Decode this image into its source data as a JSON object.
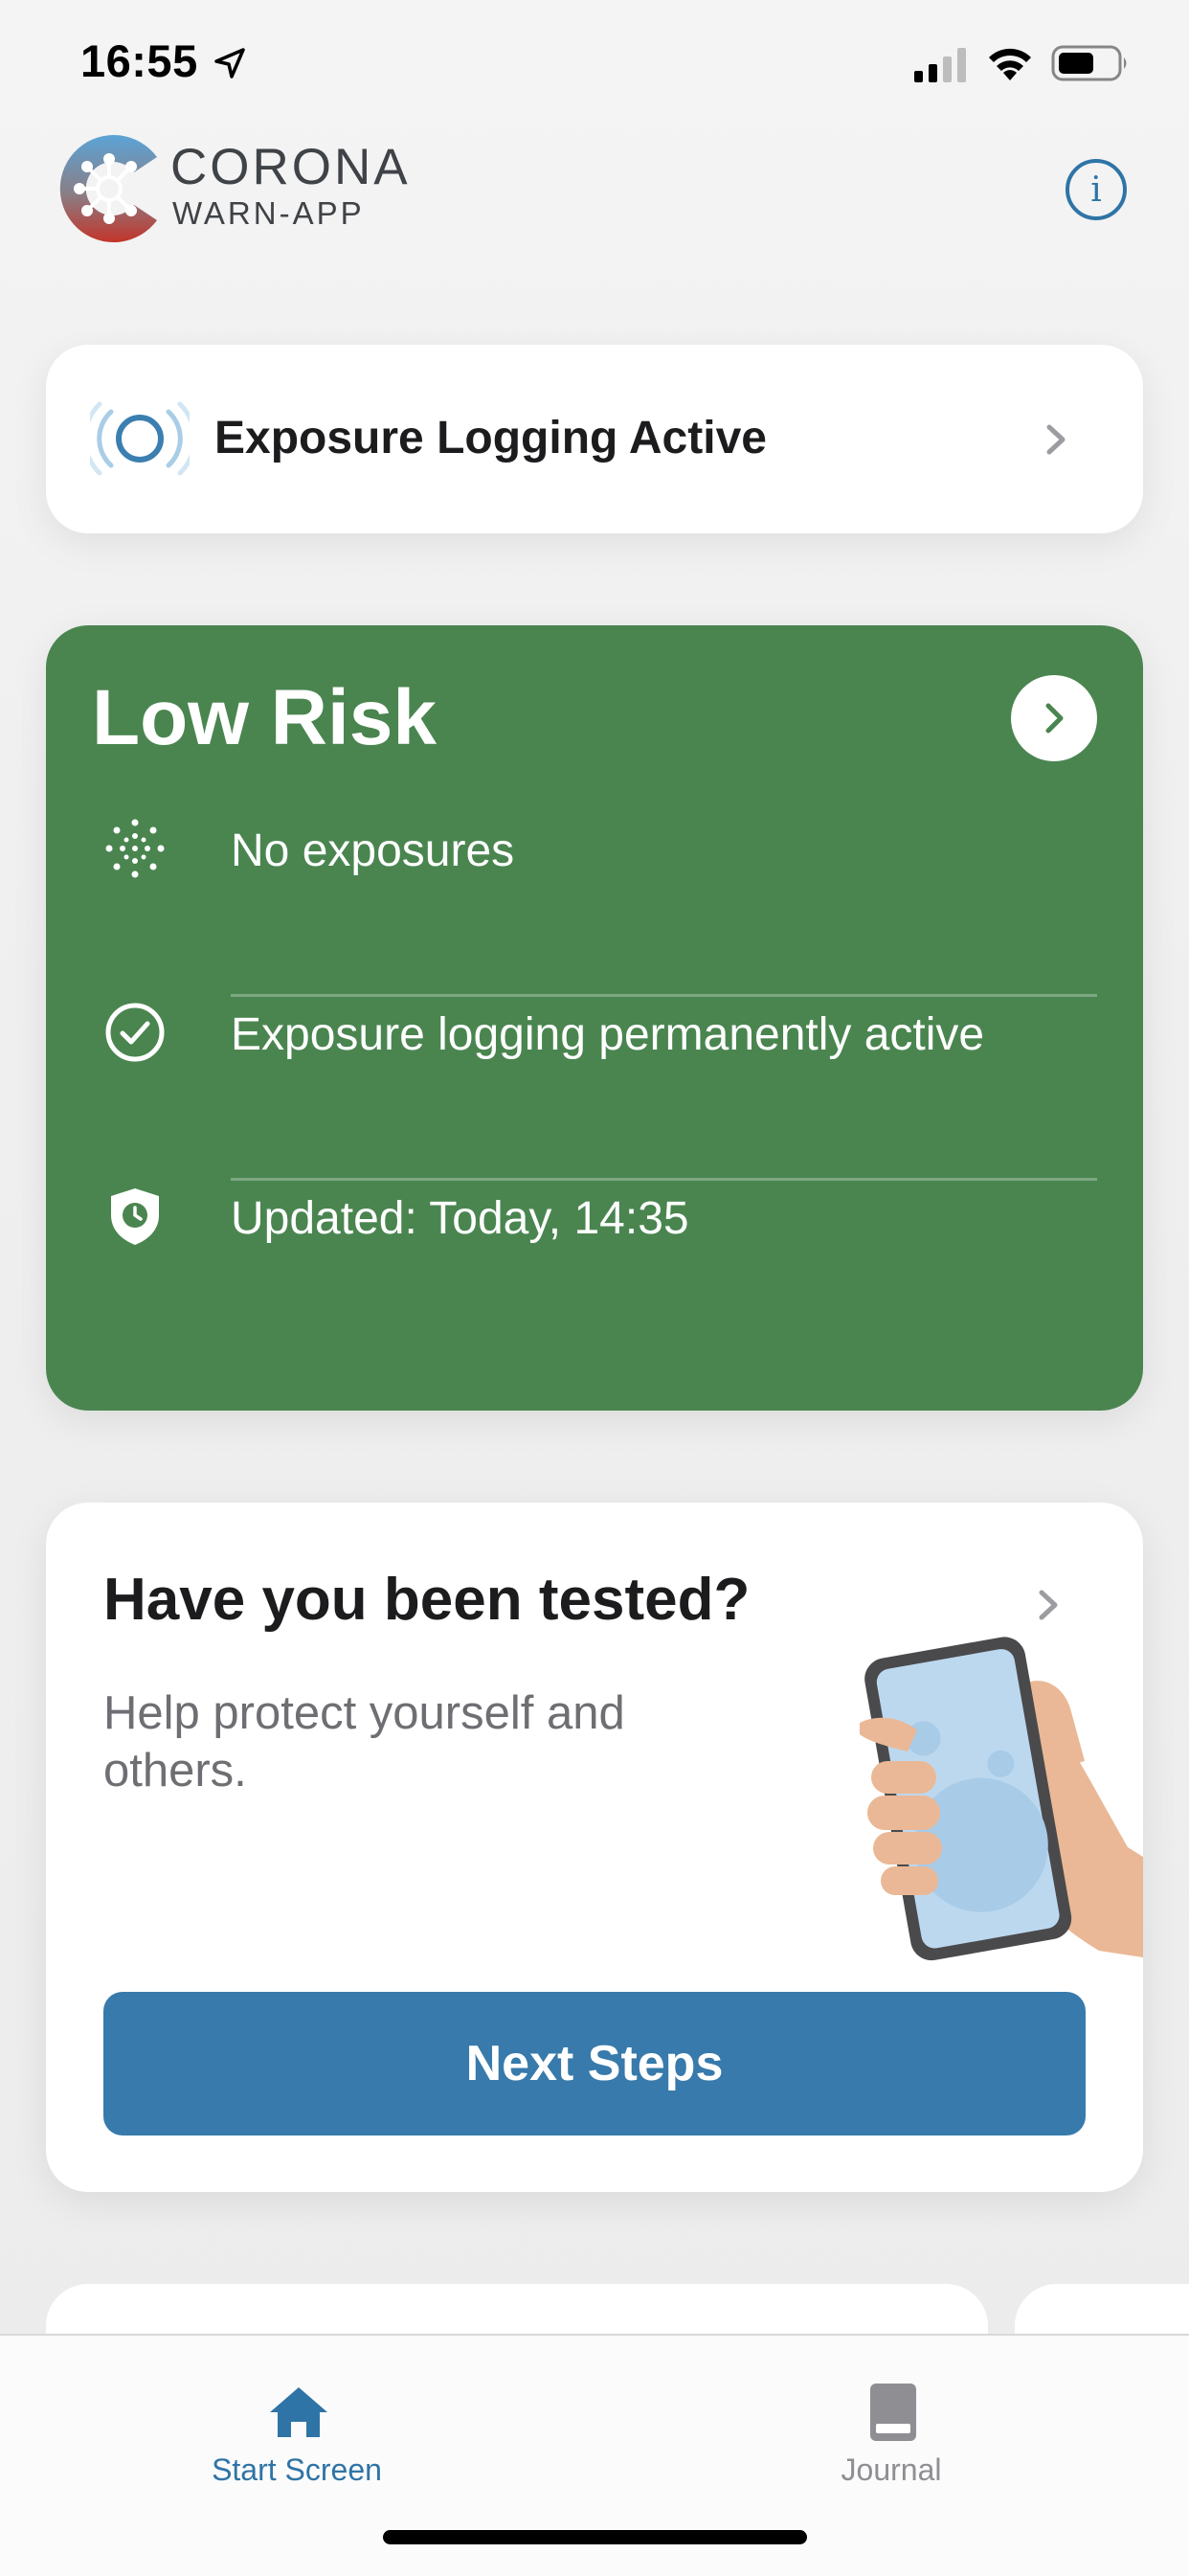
{
  "status_bar": {
    "time": "16:55",
    "location_icon": "location-arrow-icon",
    "signal_icon": "cellular-signal-icon",
    "wifi_icon": "wifi-icon",
    "battery_icon": "battery-icon"
  },
  "header": {
    "logo_line1": "CORONA",
    "logo_line2": "WARN-APP",
    "info_label": "i"
  },
  "exposure_card": {
    "title": "Exposure Logging Active"
  },
  "risk_card": {
    "title": "Low Risk",
    "color": "#4a8550",
    "rows": [
      {
        "icon": "virus-dots-icon",
        "label": "No exposures"
      },
      {
        "icon": "check-circle-icon",
        "label": "Exposure logging permanently active"
      },
      {
        "icon": "shield-clock-icon",
        "label": "Updated: Today, 14:35"
      }
    ]
  },
  "tested_card": {
    "title": "Have you been tested?",
    "subtitle": "Help protect yourself and others.",
    "button_label": "Next Steps",
    "button_color": "#377aab"
  },
  "tab_bar": {
    "items": [
      {
        "label": "Start Screen",
        "icon": "home-icon",
        "active": true
      },
      {
        "label": "Journal",
        "icon": "book-icon",
        "active": false
      }
    ],
    "accent_color": "#2f74a6"
  }
}
